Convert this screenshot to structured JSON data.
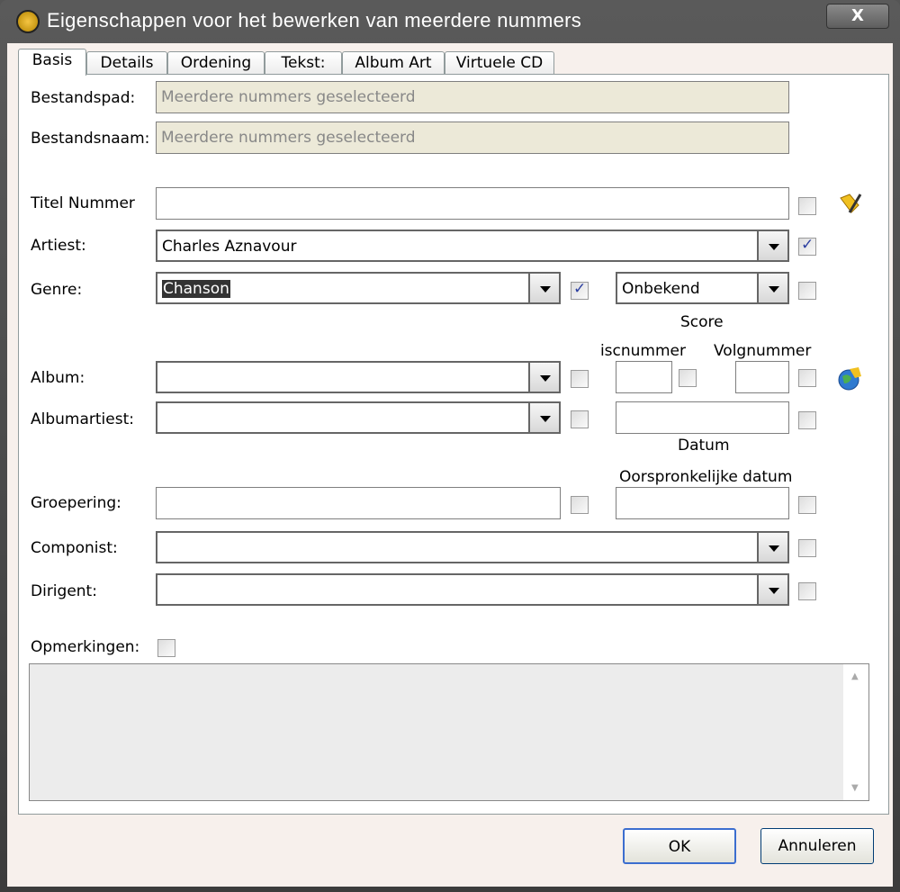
{
  "window": {
    "title": "Eigenschappen voor het bewerken van meerdere nummers",
    "close": "X"
  },
  "tabs": [
    "Basis",
    "Details",
    "Ordening",
    "Tekst:",
    "Album Art",
    "Virtuele CD"
  ],
  "fields": {
    "bestandspad": {
      "label": "Bestandspad:",
      "value": "Meerdere nummers geselecteerd"
    },
    "bestandsnaam": {
      "label": "Bestandsnaam:",
      "value": "Meerdere nummers geselecteerd"
    },
    "titel": {
      "label": "Titel Nummer",
      "value": ""
    },
    "artiest": {
      "label": "Artiest:",
      "value": "Charles Aznavour"
    },
    "genre": {
      "label": "Genre:",
      "value": "Chanson"
    },
    "score": {
      "label": "Score",
      "value": "Onbekend"
    },
    "discnummer": {
      "label": "Discnummer"
    },
    "volgnummer": {
      "label": "Volgnummer"
    },
    "album": {
      "label": "Album:"
    },
    "albumartiest": {
      "label": "Albumartiest:"
    },
    "datum": {
      "label": "Datum"
    },
    "oorspronkelijke": {
      "label": "Oorspronkelijke datum"
    },
    "groepering": {
      "label": "Groepering:"
    },
    "componist": {
      "label": "Componist:"
    },
    "dirigent": {
      "label": "Dirigent:"
    },
    "opmerkingen": {
      "label": "Opmerkingen:"
    }
  },
  "buttons": {
    "ok": "OK",
    "cancel": "Annuleren"
  }
}
